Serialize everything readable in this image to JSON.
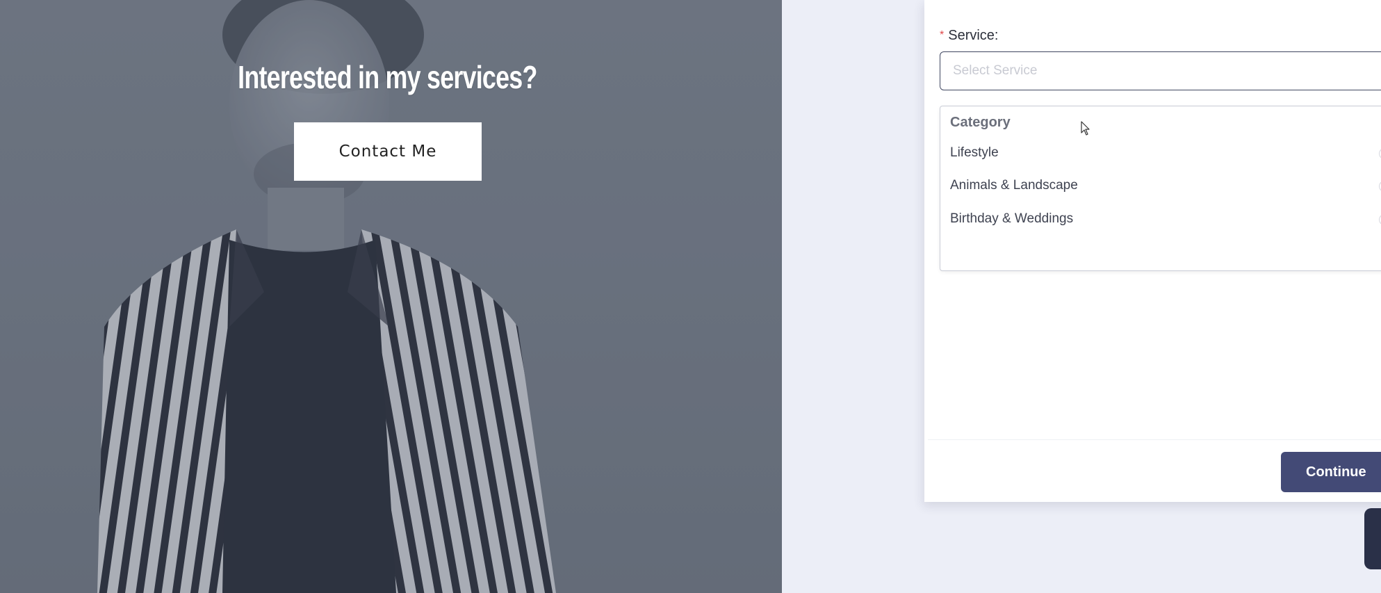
{
  "hero": {
    "title": "Interested in my services?",
    "contact_button": "Contact Me"
  },
  "form": {
    "service_label": "Service:",
    "required_mark": "*",
    "service_placeholder": "Select Service",
    "dropdown": {
      "header": "Category",
      "items": [
        {
          "label": "Lifestyle"
        },
        {
          "label": "Animals & Landscape"
        },
        {
          "label": "Birthday & Weddings"
        }
      ]
    },
    "continue_button": "Continue"
  },
  "colors": {
    "accent": "#434a76",
    "required": "#e0484a",
    "hero_overlay": "#6f7785"
  },
  "icons": {
    "cursor": "mouse-pointer-icon",
    "chat": "chat-widget-icon"
  }
}
